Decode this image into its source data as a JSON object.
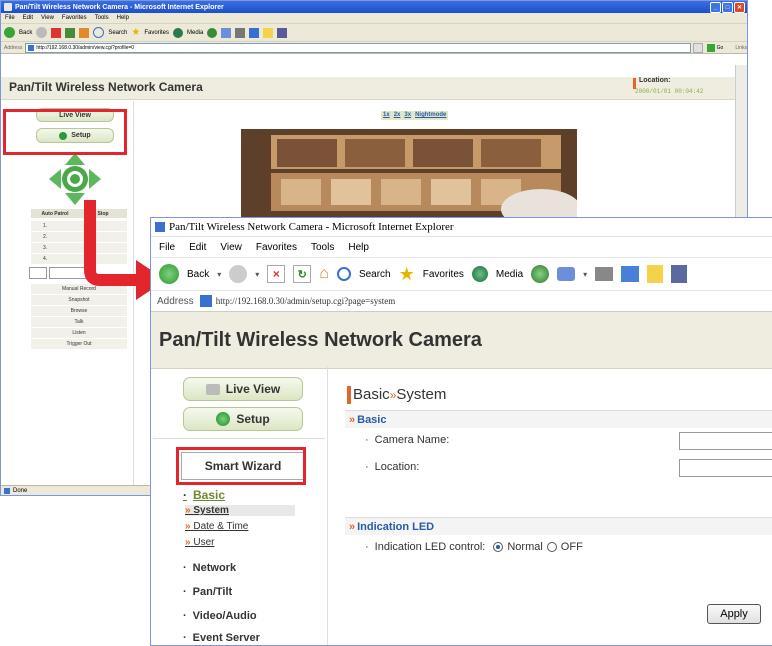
{
  "back_window": {
    "title": "Pan/Tilt Wireless Network Camera - Microsoft Internet Explorer",
    "menu": [
      "File",
      "Edit",
      "View",
      "Favorites",
      "Tools",
      "Help"
    ],
    "toolbar": {
      "back": "Back",
      "search": "Search",
      "favorites": "Favorites",
      "media": "Media",
      "go": "Go",
      "links": "Links"
    },
    "address_label": "Address",
    "address_url": "http://192.168.0.30/admin/view.cgi?profile=0",
    "page_title": "Pan/Tilt Wireless Network Camera",
    "location_label": "Location:",
    "datetime": "2000/01/01 00:04:42",
    "buttons": {
      "live_view": "Live View",
      "setup": "Setup"
    },
    "zoom_controls": {
      "x1": "1x",
      "x2": "2x",
      "x3": "3x",
      "night": "Nightmode"
    },
    "table_headers": [
      "Auto Patrol",
      "Stop"
    ],
    "patrol_rows": [
      "1.",
      "2.",
      "3.",
      "4."
    ],
    "action_buttons": [
      "Manual Record",
      "Snapshot",
      "Browse",
      "Talk",
      "Listen",
      "Trigger Out"
    ],
    "status": "Done"
  },
  "front_window": {
    "title": "Pan/Tilt Wireless Network Camera - Microsoft Internet Explorer",
    "menu": [
      "File",
      "Edit",
      "View",
      "Favorites",
      "Tools",
      "Help"
    ],
    "toolbar": {
      "back": "Back",
      "search": "Search",
      "favorites": "Favorites",
      "media": "Media"
    },
    "address_label": "Address",
    "address_url": "http://192.168.0.30/admin/setup.cgi?page=system",
    "page_title": "Pan/Tilt Wireless Network Camera",
    "buttons": {
      "live_view": "Live View",
      "setup": "Setup",
      "smart_wizard": "Smart Wizard"
    },
    "nav": {
      "basic": "Basic",
      "sub": [
        {
          "arrow": "»",
          "label": "System"
        },
        {
          "arrow": "»",
          "label": "Date & Time"
        },
        {
          "arrow": "»",
          "label": "User"
        }
      ],
      "others": [
        "Network",
        "Pan/Tilt",
        "Video/Audio",
        "Event Server"
      ]
    },
    "content": {
      "heading_a": "Basic",
      "heading_sep": "»",
      "heading_b": "System",
      "section1": "Basic",
      "camera_name_label": "Camera Name:",
      "location_label": "Location:",
      "section2": "Indication LED",
      "led_label": "Indication LED control:",
      "led_normal": "Normal",
      "led_off": "OFF",
      "apply": "Apply",
      "bullet": "·",
      "sect_arrow": "»"
    }
  },
  "colors": {
    "highlight_box": "#e3262d",
    "arrow": "#e3262d",
    "accent_orange": "#e0662b",
    "link_blue": "#2a5aa8"
  }
}
